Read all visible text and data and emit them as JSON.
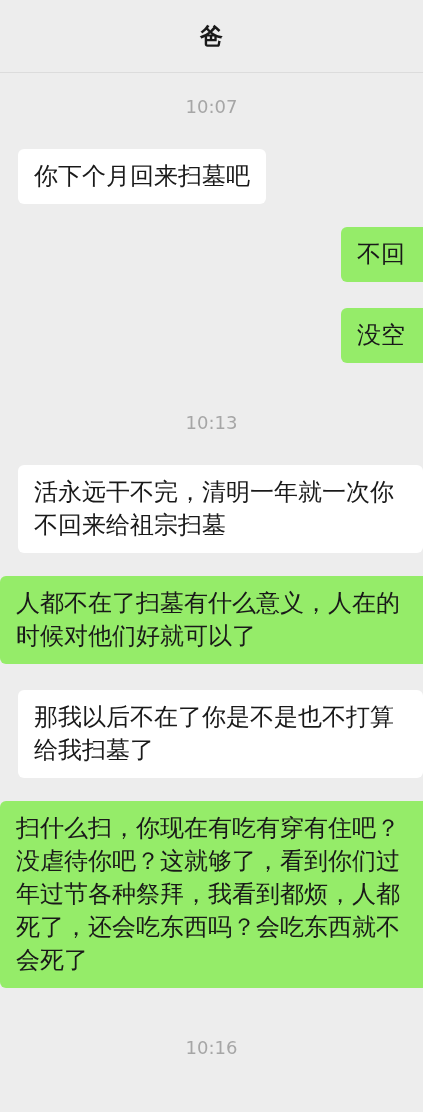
{
  "header": {
    "title": "爸"
  },
  "messages": [
    {
      "kind": "timestamp",
      "text": "10:07"
    },
    {
      "kind": "received",
      "text": "你下个月回来扫墓吧"
    },
    {
      "kind": "sent",
      "text": "不回"
    },
    {
      "kind": "sent",
      "text": "没空"
    },
    {
      "kind": "timestamp",
      "text": "10:13"
    },
    {
      "kind": "received",
      "text": "活永远干不完，清明一年就一次你不回来给祖宗扫墓"
    },
    {
      "kind": "sent",
      "text": "人都不在了扫墓有什么意义，人在的时候对他们好就可以了"
    },
    {
      "kind": "received",
      "text": "那我以后不在了你是不是也不打算给我扫墓了"
    },
    {
      "kind": "sent",
      "text": "扫什么扫，你现在有吃有穿有住吧？没虐待你吧？这就够了，看到你们过年过节各种祭拜，我看到都烦，人都死了，还会吃东西吗？会吃东西就不会死了"
    },
    {
      "kind": "timestamp",
      "text": "10:16"
    }
  ]
}
